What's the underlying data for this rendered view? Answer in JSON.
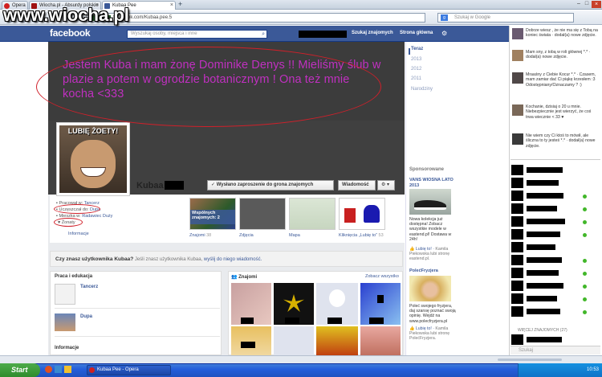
{
  "browser": {
    "tabs": [
      {
        "label": "Opera"
      },
      {
        "label": "Wiocha.pl - Absurdy polskie"
      },
      {
        "label": "Kubaa Pee"
      }
    ],
    "url": "facebook.com/Kubaa.pee.5",
    "google_placeholder": "Szukaj w Google"
  },
  "watermark": "www.wiocha.pl",
  "facebook": {
    "logo": "facebook",
    "search_placeholder": "Wyszukaj osoby, miejsca i inne",
    "nav_find_friends": "Szukaj znajomych",
    "nav_home": "Strona główna",
    "overlay_text": "Jestem Kuba i mam żonę Dominike Denys !! Mieliśmy ślub w plazie a potem w ogrodzie botanicznym ! Ona też mnie kocha <333",
    "years": [
      "Teraz",
      "2013",
      "2012",
      "2011",
      "Narodziny"
    ],
    "profile_caption": "LUBIĘ ŻOETY!",
    "profile_name": "Kubaa",
    "btn_sent": "✓ Wysłano zaproszenie do grona znajomych",
    "btn_message": "Wiadomość",
    "btn_gear": "⚙ ▾",
    "info": {
      "work_prefix": "Pracował w: ",
      "work_place": "Tancerz",
      "school_prefix": "Uczęszczał do: ",
      "school_place": "Dupa",
      "city_prefix": "Mieszka w: ",
      "city_place": "Radawiec Duży",
      "married": "Żonaty",
      "info_link": "Informacje"
    },
    "thumbs": {
      "mutual_label": "Wspólnych znajomych: 2",
      "friends": "Znajomi",
      "friends_count": "38",
      "photos": "Zdjęcia",
      "map": "Mapa",
      "likes": "Kliknięcia „Lubię to”",
      "likes_count": "53"
    },
    "prompt_bold": "Czy znasz użytkownika Kubaa?",
    "prompt_text": "Jeśli znasz użytkownika Kubaa, ",
    "prompt_link": "wyślij do niego wiadomość.",
    "work_edu_title": "Praca i edukacja",
    "work_item": "Tancerz",
    "edu_item": "Dupa",
    "info_title": "Informacje",
    "friends_title": "Znajomi",
    "see_all": "Zobacz wszystko",
    "sponsored": "Sponsorowane",
    "ad1_title": "VANS WIOSNA LATO 2013",
    "ad1_text": "Nowa kolekcja już dostępna! Zobacz wszystkie modele w eastend.pl! Dostawa w 24h!",
    "ad1_like": "👍 Lubię to! · ",
    "ad1_social": "Kamila Piekowska lubi stronę eastend.pl.",
    "ad2_title": "PolećFryzjera",
    "ad2_text": "Poleć swojego fryzjera, daj szansę poznać swoją opinię. Wejdź na www.polecfryzjera.pl",
    "ad2_like": "👍 Lubię to! · ",
    "ad2_social": "Kamila Piekowska lubi stronę PolećFryzjera."
  },
  "ticker": [
    {
      "text": "Dobrze wiesz , że nie ma się z Tobą na koniec świata · dodał(a) nowe zdjęcie."
    },
    {
      "text": "Mam sny, z tobą w roli głównej *.* · dodał(a) nowe zdjęcie."
    },
    {
      "text": "Mraaśny z Ciebie Kocur *.* · Czasem, mam zamiar dać Ci piąkę krzesłem :3 Odostępniany/Oznaczamy ? :)"
    },
    {
      "text": "Kochanie, dzisiaj o 20 u mnie. Niebezpiecznie jest wierzyć, że coś trwa wiecznie < 33 ♥"
    },
    {
      "text": "Nie wiem czy Ci ktoś to mówił, ale śliczna to ty jesteś *.* · dodał(a) nowe zdjęcie."
    }
  ],
  "chat_more": "WIĘCEJ ZNAJOMYCH (27)",
  "chat_search": "Szukaj",
  "taskbar": {
    "start": "Start",
    "item": "Kubaa Pee - Opera",
    "clock": "10:53"
  }
}
